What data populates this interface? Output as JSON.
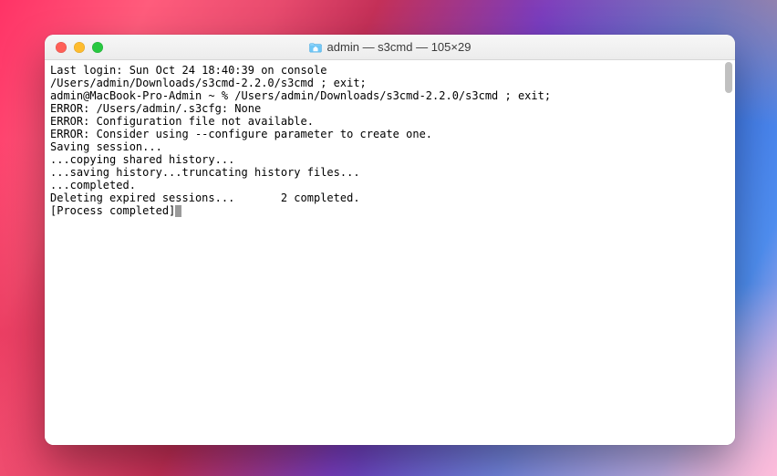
{
  "window": {
    "title": "admin — s3cmd — 105×29",
    "icon": "home-folder-icon"
  },
  "traffic_lights": {
    "close": "Close",
    "minimize": "Minimize",
    "zoom": "Zoom"
  },
  "terminal": {
    "lines": [
      "Last login: Sun Oct 24 18:40:39 on console",
      "/Users/admin/Downloads/s3cmd-2.2.0/s3cmd ; exit;",
      "admin@MacBook-Pro-Admin ~ % /Users/admin/Downloads/s3cmd-2.2.0/s3cmd ; exit;",
      "ERROR: /Users/admin/.s3cfg: None",
      "ERROR: Configuration file not available.",
      "ERROR: Consider using --configure parameter to create one.",
      "Saving session...",
      "...copying shared history...",
      "...saving history...truncating history files...",
      "...completed.",
      "Deleting expired sessions...       2 completed.",
      "",
      "[Process completed]"
    ],
    "cursor_after_last": true
  }
}
